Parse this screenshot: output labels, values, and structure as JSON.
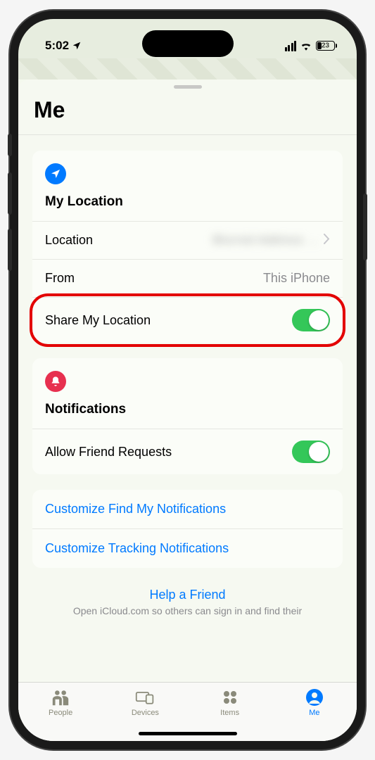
{
  "status": {
    "time": "5:02",
    "battery_pct": "23"
  },
  "sheet": {
    "title": "Me"
  },
  "location_section": {
    "title": "My Location",
    "location_label": "Location",
    "location_value": "Blurred Address …",
    "from_label": "From",
    "from_value": "This iPhone",
    "share_label": "Share My Location"
  },
  "notifications_section": {
    "title": "Notifications",
    "allow_label": "Allow Friend Requests"
  },
  "links": {
    "customize_findmy": "Customize Find My Notifications",
    "customize_tracking": "Customize Tracking Notifications"
  },
  "help": {
    "link": "Help a Friend",
    "text": "Open iCloud.com so others can sign in and find their"
  },
  "tabs": {
    "people": "People",
    "devices": "Devices",
    "items": "Items",
    "me": "Me"
  }
}
